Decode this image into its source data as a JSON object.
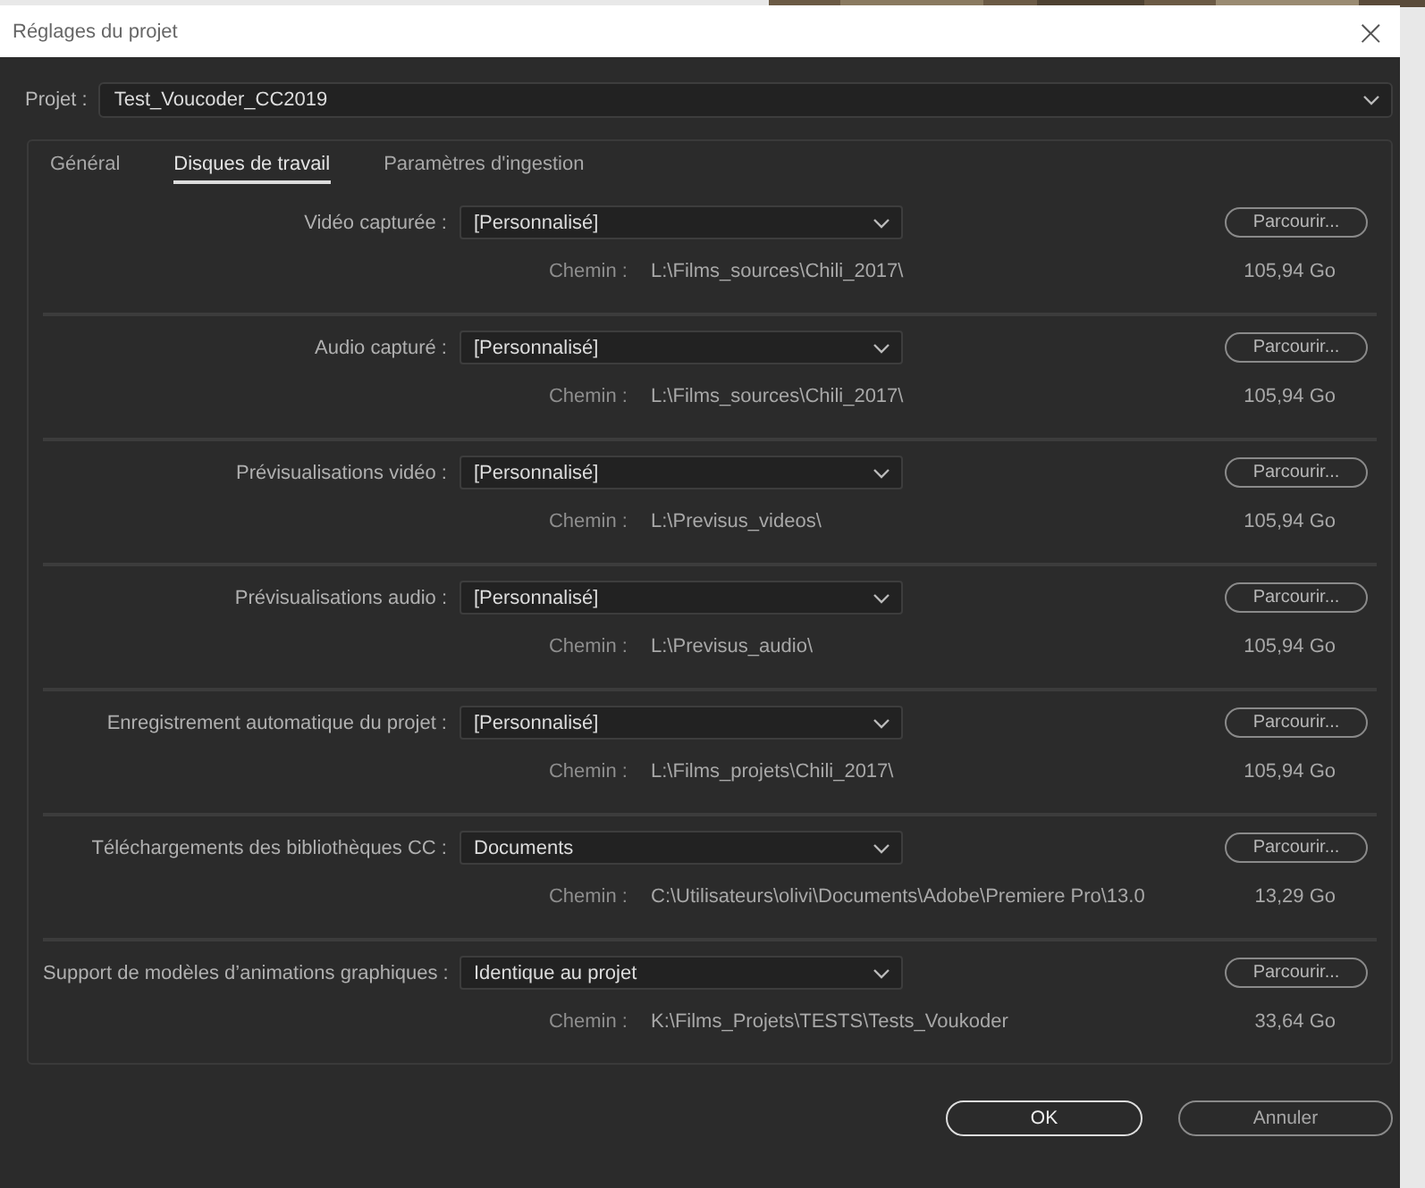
{
  "window": {
    "title": "Réglages du projet",
    "close": "×"
  },
  "project": {
    "label": "Projet :",
    "value": "Test_Voucoder_CC2019"
  },
  "tabs": [
    {
      "label": "Général",
      "selected": false
    },
    {
      "label": "Disques de travail",
      "selected": true
    },
    {
      "label": "Paramètres d'ingestion",
      "selected": false
    }
  ],
  "rows": [
    {
      "label": "Vidéo capturée :",
      "value": "[Personnalisé]",
      "button": "Parcourir...",
      "path_label": "Chemin :",
      "path": "L:\\Films_sources\\Chili_2017\\",
      "size": "105,94 Go"
    },
    {
      "label": "Audio capturé :",
      "value": "[Personnalisé]",
      "button": "Parcourir...",
      "path_label": "Chemin :",
      "path": "L:\\Films_sources\\Chili_2017\\",
      "size": "105,94 Go"
    },
    {
      "label": "Prévisualisations vidéo :",
      "value": "[Personnalisé]",
      "button": "Parcourir...",
      "path_label": "Chemin :",
      "path": "L:\\Previsus_videos\\",
      "size": "105,94 Go"
    },
    {
      "label": "Prévisualisations audio :",
      "value": "[Personnalisé]",
      "button": "Parcourir...",
      "path_label": "Chemin :",
      "path": "L:\\Previsus_audio\\",
      "size": "105,94 Go"
    },
    {
      "label": "Enregistrement automatique du projet :",
      "value": "[Personnalisé]",
      "button": "Parcourir...",
      "path_label": "Chemin :",
      "path": "L:\\Films_projets\\Chili_2017\\",
      "size": "105,94 Go"
    },
    {
      "label": "Téléchargements des bibliothèques CC :",
      "value": "Documents",
      "button": "Parcourir...",
      "path_label": "Chemin :",
      "path": "C:\\Utilisateurs\\olivi\\Documents\\Adobe\\Premiere Pro\\13.0",
      "size": "13,29 Go"
    },
    {
      "label": "Support de modèles d’animations graphiques :",
      "value": "Identique au projet",
      "button": "Parcourir...",
      "path_label": "Chemin :",
      "path": "K:\\Films_Projets\\TESTS\\Tests_Voukoder",
      "size": "33,64 Go"
    }
  ],
  "buttons": [
    "OK",
    "Annuler"
  ]
}
